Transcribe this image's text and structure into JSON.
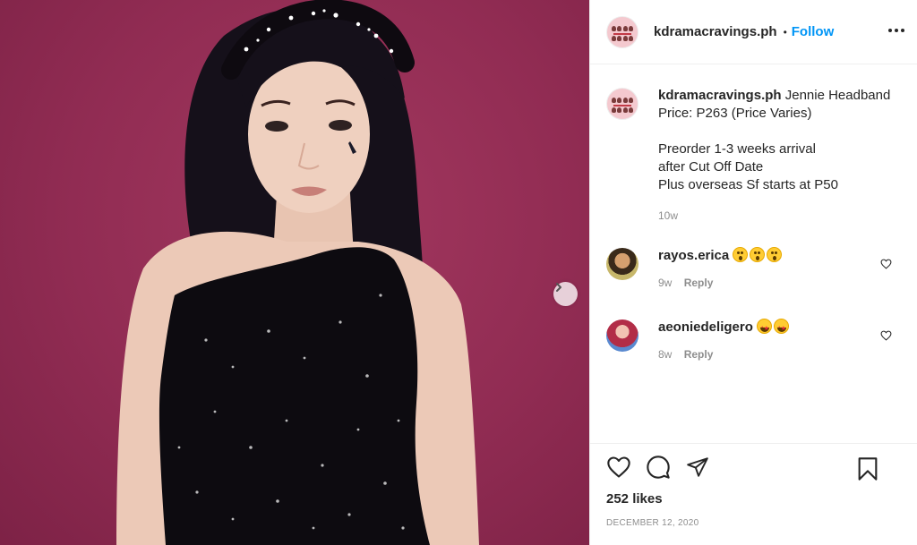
{
  "post": {
    "username": "kdramacravings.ph",
    "follow_label": "Follow",
    "separator": "•"
  },
  "caption": {
    "username": "kdramacravings.ph",
    "text": " Jennie Headband\nPrice: P263 (Price Varies)\n\nPreorder 1-3 weeks arrival\nafter Cut Off Date\nPlus overseas Sf starts at P50",
    "time": "10w"
  },
  "comments": [
    {
      "username": "rayos.erica",
      "emoji": "😮😮😮",
      "time": "9w",
      "reply_label": "Reply"
    },
    {
      "username": "aeoniedeligero",
      "emoji": "🤩🤩",
      "time": "8w",
      "reply_label": "Reply"
    }
  ],
  "footer": {
    "likes": "252 likes",
    "date": "DECEMBER 12, 2020"
  },
  "icons": {
    "more": "more-options-icon",
    "like": "heart-icon",
    "comment": "comment-icon",
    "share": "share-icon",
    "save": "bookmark-icon",
    "next": "chevron-right-icon"
  },
  "colors": {
    "accent": "#0095f6",
    "muted": "#8e8e8e",
    "photo_background": "#912c53"
  }
}
